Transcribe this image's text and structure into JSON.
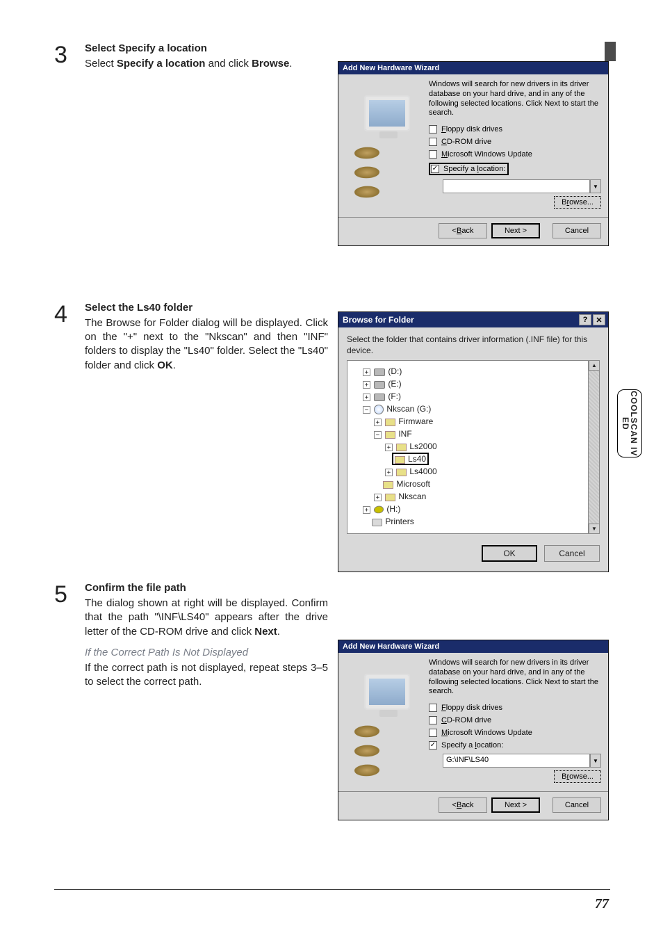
{
  "side_tab": "COOLSCAN\nIV ED",
  "steps": [
    {
      "num": "3",
      "title": "Select Specify a location",
      "body_html": "Select <b>Specify a location</b> and click <b>Browse</b>."
    },
    {
      "num": "4",
      "title": "Select the Ls40 folder",
      "body_html": "The Browse for Folder dialog will be displayed. Click on the \"+\" next to the \"Nkscan\" and then \"INF\" folders to display the \"Ls40\" folder. Select the \"Ls40\" folder and click <b>OK</b>."
    },
    {
      "num": "5",
      "title": "Confirm the file path",
      "body_html": "The dialog shown at right will be displayed. Confirm that the path \"\\INF\\LS40\" appears after the drive letter of the CD-ROM drive and click <b>Next</b>.",
      "italic_title": "If the Correct Path Is Not Displayed",
      "italic_body": "If the correct path is not displayed, repeat steps 3–5 to select the correct path."
    }
  ],
  "wizard": {
    "title": "Add New Hardware Wizard",
    "desc": "Windows will search for new drivers in its driver database on your hard drive, and in any of the following selected locations. Click Next to start the search.",
    "options": {
      "floppy": "Floppy disk drives",
      "cdrom": "CD-ROM drive",
      "msupdate": "Microsoft Windows Update",
      "specify": "Specify a location:"
    },
    "path_value_empty": "",
    "path_value_filled": "G:\\INF\\LS40",
    "browse": "Browse...",
    "back": "< Back",
    "next": "Next >",
    "cancel": "Cancel"
  },
  "browse_folder": {
    "title": "Browse for Folder",
    "help_icon": "?",
    "close_icon": "✕",
    "text": "Select the folder that contains driver information (.INF file) for this device.",
    "tree": {
      "d": "(D:)",
      "e": "(E:)",
      "f": "(F:)",
      "nkscan_g": "Nkscan (G:)",
      "firmware": "Firmware",
      "inf": "INF",
      "ls2000": "Ls2000",
      "ls40": "Ls40",
      "ls4000": "Ls4000",
      "microsoft": "Microsoft",
      "nkscan": "Nkscan",
      "h": "(H:)",
      "printers": "Printers"
    },
    "ok": "OK",
    "cancel": "Cancel"
  },
  "page_number": "77"
}
